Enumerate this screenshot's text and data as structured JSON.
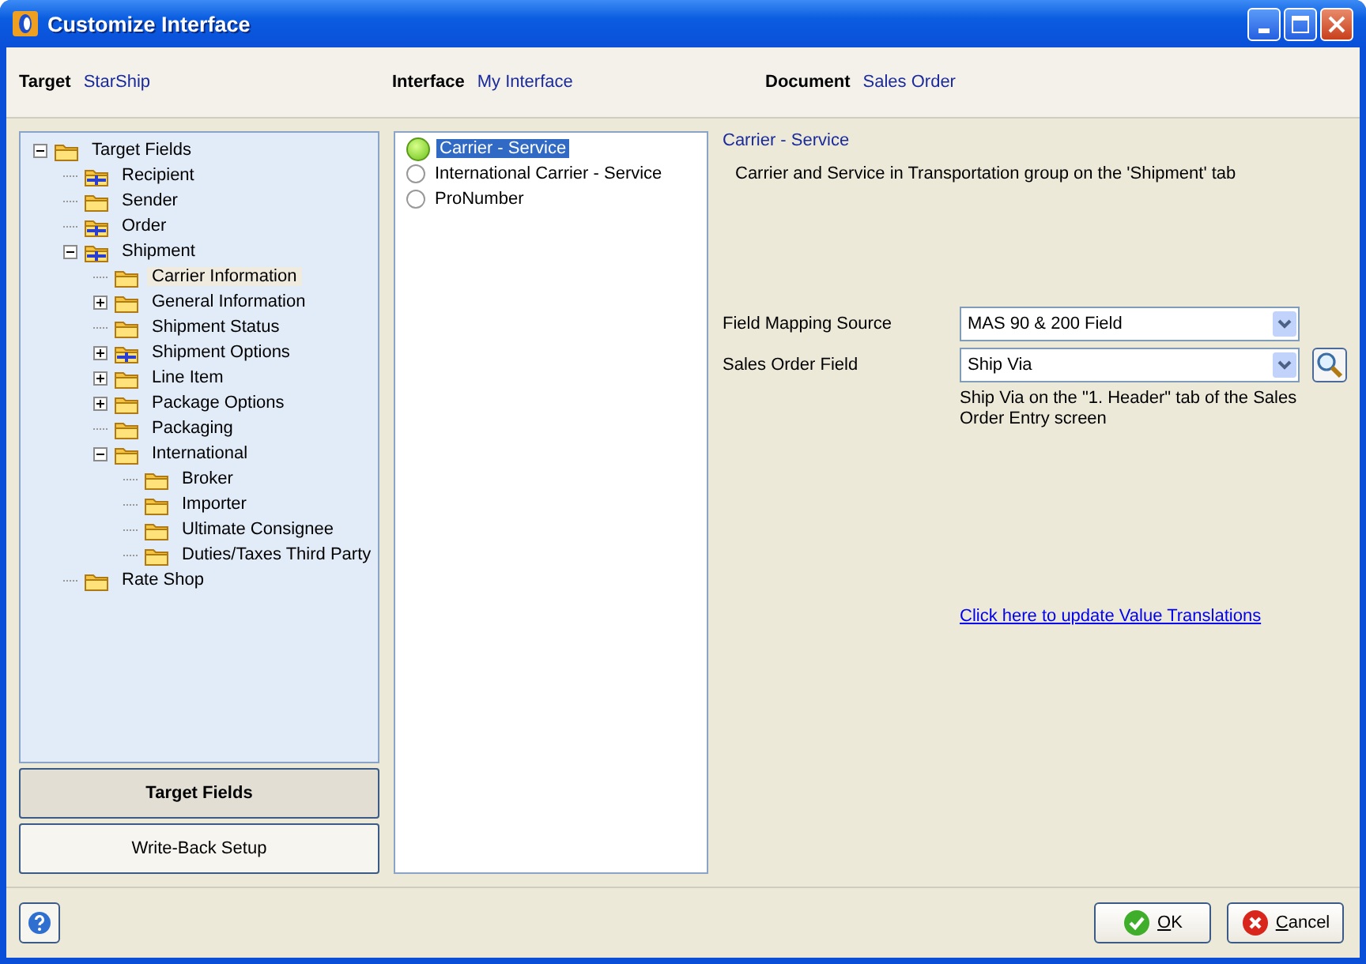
{
  "window": {
    "title": "Customize Interface"
  },
  "header": [
    {
      "label": "Target",
      "value": "StarShip"
    },
    {
      "label": "Interface",
      "value": "My Interface"
    },
    {
      "label": "Document",
      "value": "Sales Order"
    }
  ],
  "tree": [
    {
      "label": "Target Fields",
      "kind": "folder",
      "expanded": true,
      "selected": false,
      "children": [
        {
          "label": "Recipient",
          "kind": "group",
          "selected": false
        },
        {
          "label": "Sender",
          "kind": "folder",
          "selected": false
        },
        {
          "label": "Order",
          "kind": "group",
          "selected": false
        },
        {
          "label": "Shipment",
          "kind": "group",
          "expanded": true,
          "selected": false,
          "children": [
            {
              "label": "Carrier Information",
              "kind": "folder",
              "selected": true
            },
            {
              "label": "General Information",
              "kind": "folder",
              "expanded": false,
              "selected": false
            },
            {
              "label": "Shipment Status",
              "kind": "folder",
              "selected": false
            },
            {
              "label": "Shipment Options",
              "kind": "group",
              "expanded": false,
              "selected": false
            },
            {
              "label": "Line Item",
              "kind": "folder",
              "expanded": false,
              "selected": false
            },
            {
              "label": "Package Options",
              "kind": "folder",
              "expanded": false,
              "selected": false
            },
            {
              "label": "Packaging",
              "kind": "folder",
              "selected": false
            },
            {
              "label": "International",
              "kind": "folder",
              "expanded": true,
              "selected": false,
              "children": [
                {
                  "label": "Broker",
                  "kind": "folder",
                  "selected": false
                },
                {
                  "label": "Importer",
                  "kind": "folder",
                  "selected": false
                },
                {
                  "label": "Ultimate Consignee",
                  "kind": "folder",
                  "selected": false
                },
                {
                  "label": "Duties/Taxes Third Party",
                  "kind": "folder",
                  "selected": false
                }
              ]
            }
          ]
        },
        {
          "label": "Rate Shop",
          "kind": "folder",
          "selected": false
        }
      ]
    }
  ],
  "nav_buttons": [
    {
      "label": "Target Fields",
      "selected": true
    },
    {
      "label": "Write-Back Setup",
      "selected": false
    }
  ],
  "fields": [
    {
      "label": "Carrier - Service",
      "selected": true,
      "mapped": true
    },
    {
      "label": "International Carrier - Service",
      "selected": false,
      "mapped": false
    },
    {
      "label": "ProNumber",
      "selected": false,
      "mapped": false
    }
  ],
  "detail": {
    "title": "Carrier - Service",
    "description": "Carrier and Service in Transportation group on the 'Shipment' tab",
    "mapping_source": {
      "label": "Field Mapping Source",
      "value": "MAS 90 & 200 Field"
    },
    "sales_order_field": {
      "label": "Sales Order Field",
      "value": "Ship Via",
      "note": "Ship Via on the \"1. Header\" tab of the Sales Order Entry screen"
    },
    "link": "Click here to update Value Translations"
  },
  "footer": {
    "ok": "OK",
    "cancel": "Cancel"
  }
}
